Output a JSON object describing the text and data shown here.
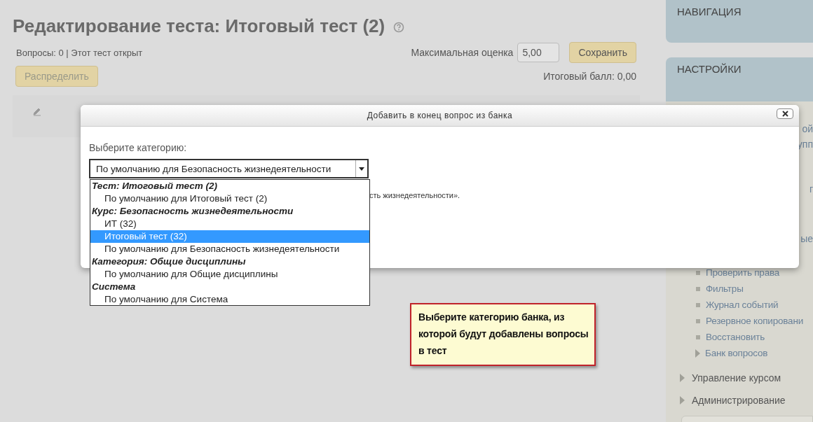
{
  "page": {
    "title": "Редактирование теста: Итоговый тест (2)",
    "status": "Вопросы: 0 | Этот тест открыт",
    "max_grade_label": "Максимальная оценка",
    "max_grade": "5,00",
    "save": "Сохранить",
    "distribute": "Распределить",
    "total": "Итоговый балл: 0,00"
  },
  "dialog": {
    "title": "Добавить в конец вопрос из банка",
    "category_label": "Выберите категорию:",
    "selected_value": "По умолчанию для Безопасность жизнедеятельности",
    "note_fragment": "сть жизнедеятельности».",
    "options": [
      {
        "label": "Тест: Итоговый тест (2)",
        "kind": "group",
        "selected": false
      },
      {
        "label": "По умолчанию для Итоговый тест (2)",
        "kind": "option",
        "selected": false
      },
      {
        "label": "Курс: Безопасность жизнедеятельности",
        "kind": "group",
        "selected": false
      },
      {
        "label": "ИТ (32)",
        "kind": "option",
        "selected": false
      },
      {
        "label": "Итоговый тест (32)",
        "kind": "option",
        "selected": true
      },
      {
        "label": "По умолчанию для Безопасность жизнедеятельности",
        "kind": "option",
        "selected": false
      },
      {
        "label": "Категория: Общие дисциплины",
        "kind": "group",
        "selected": false
      },
      {
        "label": "По умолчанию для Общие дисциплины",
        "kind": "option",
        "selected": false
      },
      {
        "label": "Система",
        "kind": "group",
        "selected": false
      },
      {
        "label": "По умолчанию для Система",
        "kind": "option",
        "selected": false
      }
    ]
  },
  "sidebar": {
    "navigation": "НАВИГАЦИЯ",
    "settings": "НАСТРОЙКИ",
    "fragments": [
      "ой",
      "упп",
      "г",
      "ые"
    ],
    "items": [
      {
        "label": "Проверить права",
        "kind": "bullet"
      },
      {
        "label": "Фильтры",
        "kind": "bullet"
      },
      {
        "label": "Журнал событий",
        "kind": "bullet"
      },
      {
        "label": "Резервное копировани",
        "kind": "bullet"
      },
      {
        "label": "Восстановить",
        "kind": "bullet"
      },
      {
        "label": "Банк вопросов",
        "kind": "arrow"
      }
    ],
    "sections": [
      "Управление курсом",
      "Администрирование"
    ]
  },
  "callout": "Выберите категорию банка, из которой будут добавлены вопросы в тест"
}
